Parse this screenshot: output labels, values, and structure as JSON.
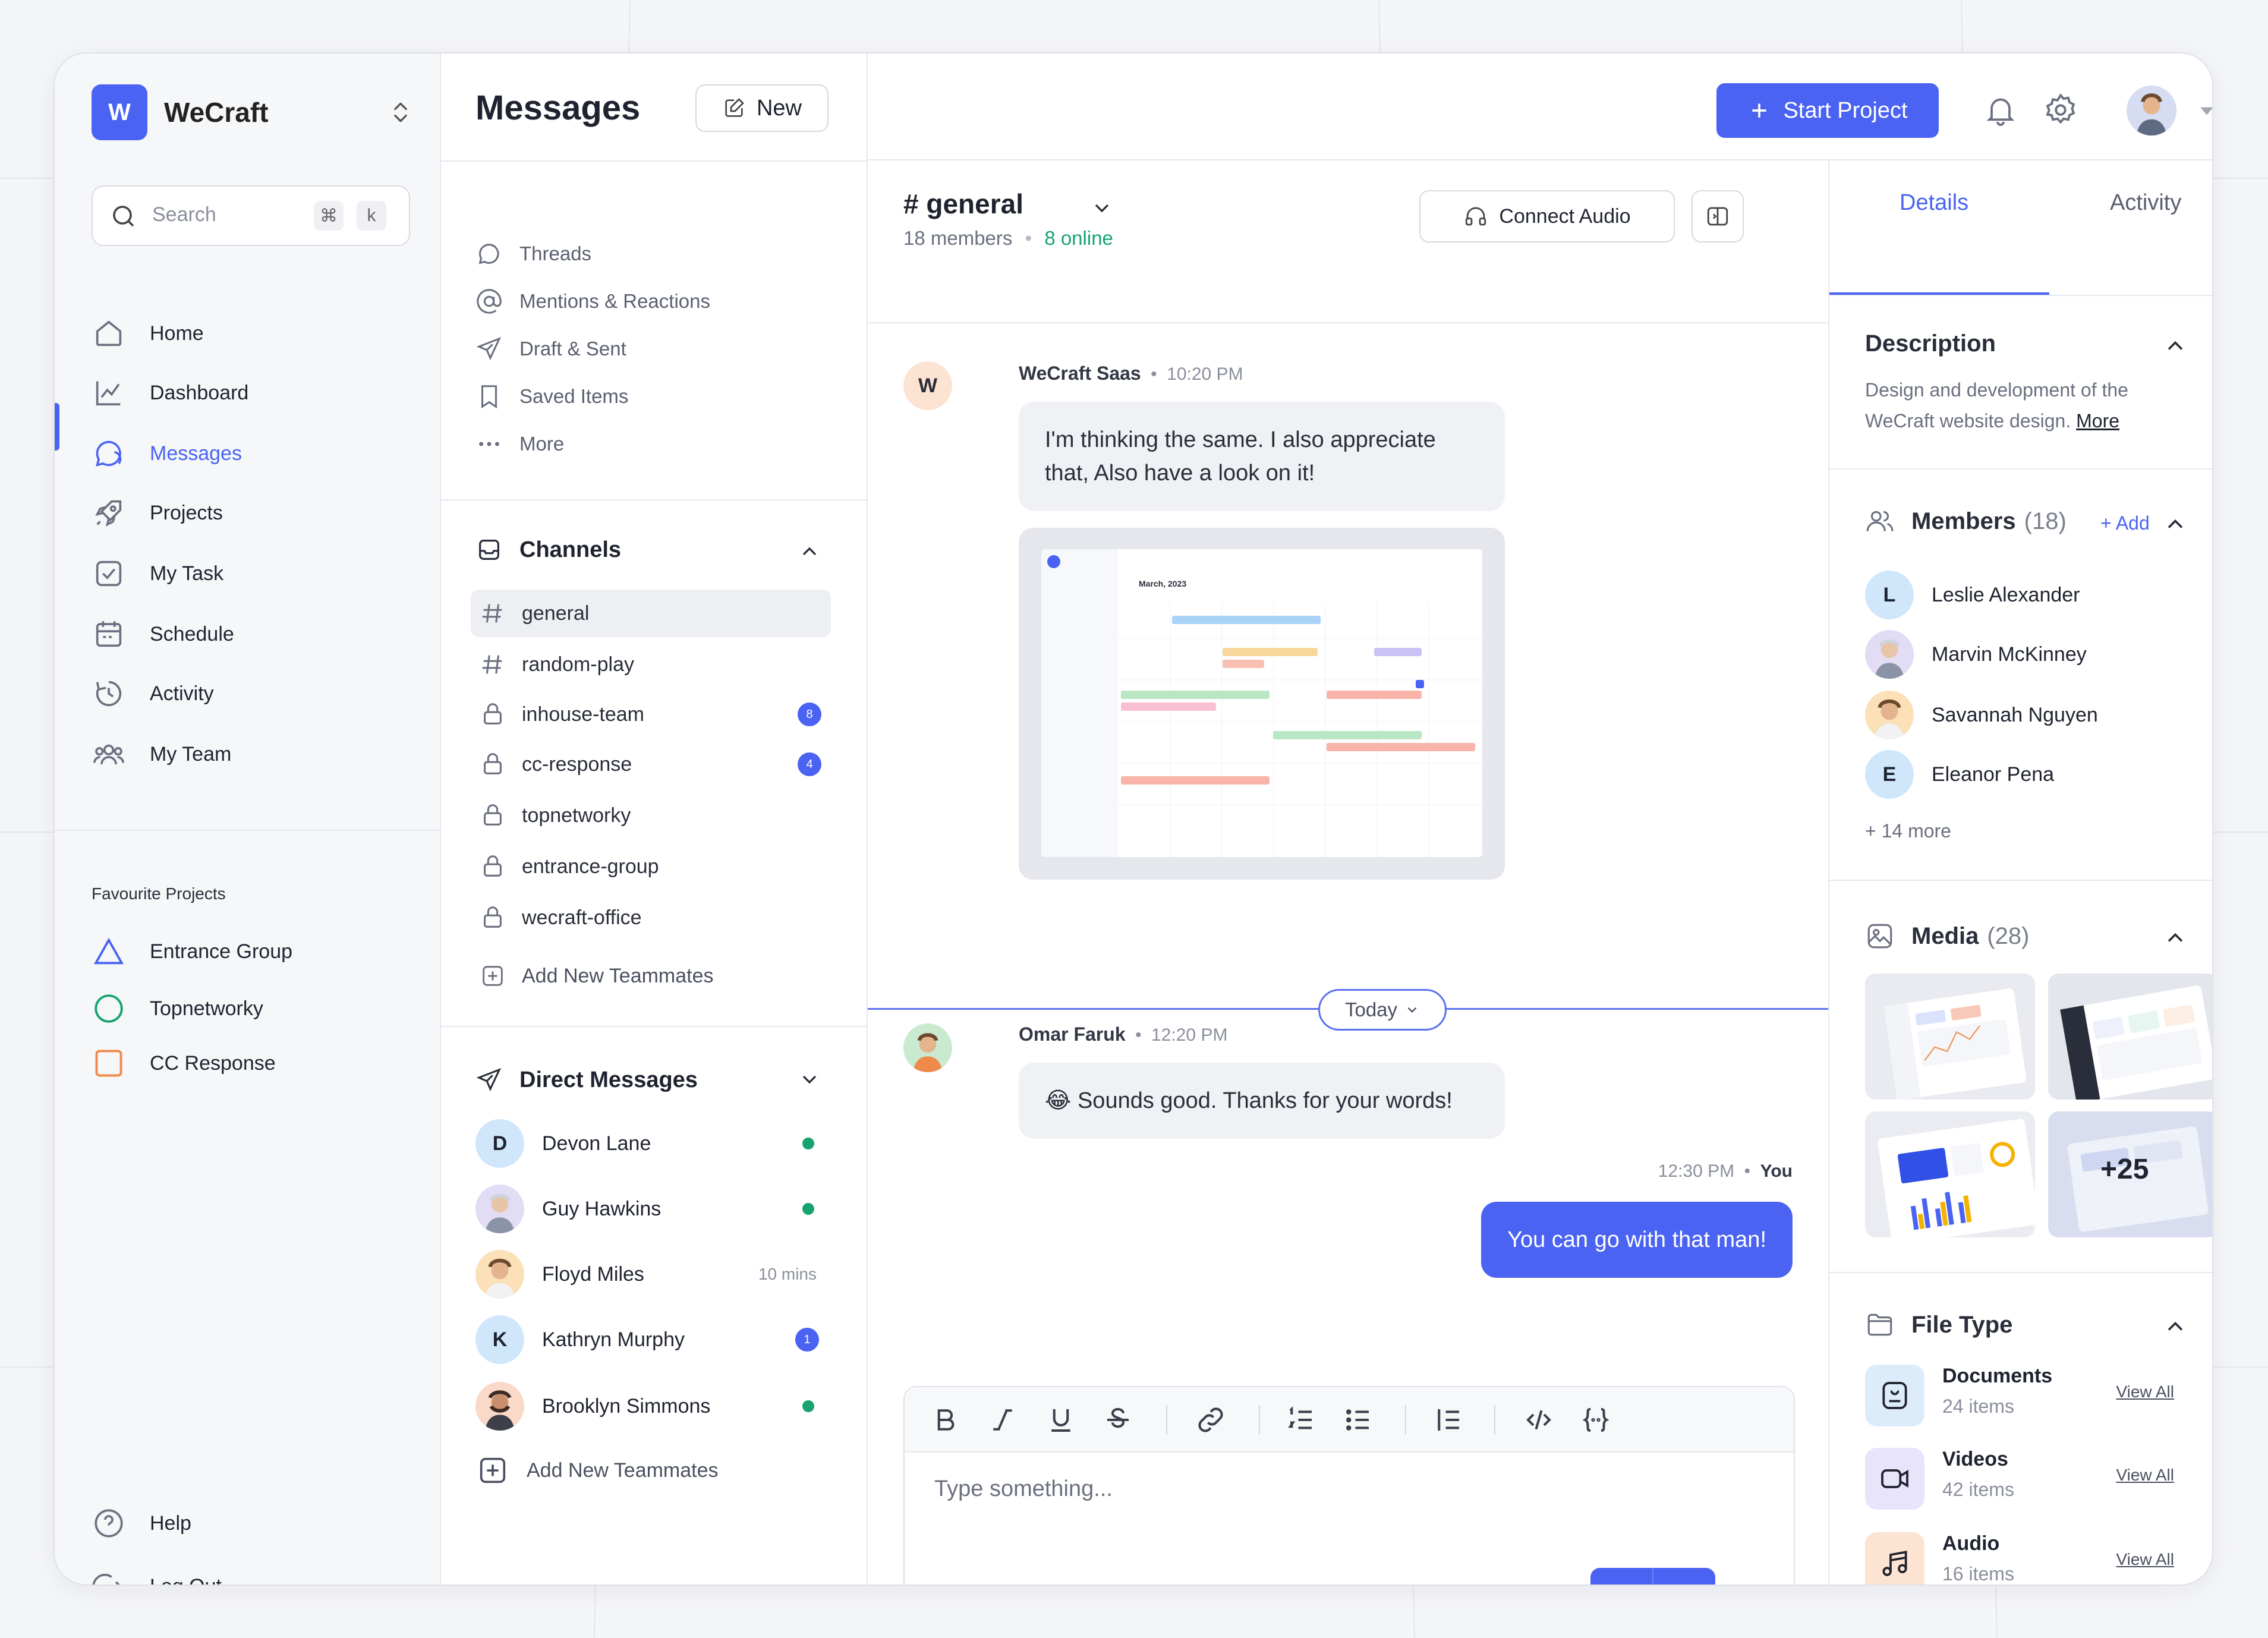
{
  "app": {
    "logo_letter": "W",
    "name": "WeCraft"
  },
  "search": {
    "placeholder": "Search",
    "shortcut_key1": "⌘",
    "shortcut_key2": "k"
  },
  "nav": [
    {
      "label": "Home",
      "icon": "home-icon"
    },
    {
      "label": "Dashboard",
      "icon": "chart-icon"
    },
    {
      "label": "Messages",
      "icon": "messages-icon",
      "active": true
    },
    {
      "label": "Projects",
      "icon": "rocket-icon"
    },
    {
      "label": "My Task",
      "icon": "checkbox-icon"
    },
    {
      "label": "Schedule",
      "icon": "calendar-icon"
    },
    {
      "label": "Activity",
      "icon": "activity-icon"
    },
    {
      "label": "My Team",
      "icon": "team-icon"
    }
  ],
  "favourites": {
    "title": "Favourite Projects",
    "items": [
      {
        "label": "Entrance Group",
        "color": "#4a63f2"
      },
      {
        "label": "Topnetworky",
        "color": "#16a36f"
      },
      {
        "label": "CC Response",
        "color": "#f08a4b"
      }
    ]
  },
  "bottom_nav": {
    "help": "Help",
    "logout": "Log Out"
  },
  "messages": {
    "title": "Messages",
    "new_label": "New",
    "menu": [
      "Threads",
      "Mentions & Reactions",
      "Draft & Sent",
      "Saved Items",
      "More"
    ],
    "channels_title": "Channels",
    "channels": [
      {
        "name": "general",
        "type": "hash",
        "active": true
      },
      {
        "name": "random-play",
        "type": "hash"
      },
      {
        "name": "inhouse-team",
        "type": "lock",
        "badge": "8"
      },
      {
        "name": "cc-response",
        "type": "lock",
        "badge": "4"
      },
      {
        "name": "topnetworky",
        "type": "lock"
      },
      {
        "name": "entrance-group",
        "type": "lock"
      },
      {
        "name": "wecraft-office",
        "type": "lock"
      }
    ],
    "add_teammates": "Add New Teammates",
    "dm_title": "Direct Messages",
    "dms": [
      {
        "name": "Devon Lane",
        "initial": "D",
        "status": "online"
      },
      {
        "name": "Guy Hawkins",
        "initial": "",
        "status": "online"
      },
      {
        "name": "Floyd Miles",
        "initial": "",
        "meta": "10 mins"
      },
      {
        "name": "Kathryn Murphy",
        "initial": "K",
        "badge": "1"
      },
      {
        "name": "Brooklyn Simmons",
        "initial": "",
        "status": "online"
      }
    ],
    "dm_add": "Add New Teammates"
  },
  "topbar": {
    "start_project": "Start Project"
  },
  "chat": {
    "channel": "# general",
    "members": "18 members",
    "online": "8 online",
    "connect_audio": "Connect Audio",
    "messages": [
      {
        "sender": "WeCraft Saas",
        "avatar": "W",
        "time": "10:20 PM",
        "text": "I'm thinking the same. I also appreciate that, Also have a look on it!"
      },
      {
        "sender": "Omar Faruk",
        "time": "12:20 PM",
        "text": "😂 Sounds good. Thanks for your words!"
      },
      {
        "time": "12:30 PM",
        "sender_self": "You",
        "text": "You can go with that man!"
      }
    ],
    "preview": {
      "month": "March, 2023"
    },
    "today": "Today",
    "composer_placeholder": "Type something..."
  },
  "details": {
    "tabs": [
      "Details",
      "Activity"
    ],
    "description_title": "Description",
    "description_text_1": "Design and development of the",
    "description_text_2": "WeCraft website design.",
    "description_more": "More",
    "members_title": "Members",
    "members_count": "(18)",
    "members_add": "+ Add",
    "members": [
      {
        "name": "Leslie Alexander",
        "initial": "L"
      },
      {
        "name": "Marvin McKinney",
        "initial": ""
      },
      {
        "name": "Savannah Nguyen",
        "initial": ""
      },
      {
        "name": "Eleanor Pena",
        "initial": "E"
      }
    ],
    "members_more": "+ 14 more",
    "media_title": "Media",
    "media_count": "(28)",
    "media_extra": "+25",
    "filetype_title": "File Type",
    "files": [
      {
        "name": "Documents",
        "count": "24 items",
        "color": "#dcecfb",
        "icon": "document-icon"
      },
      {
        "name": "Videos",
        "count": "42 items",
        "color": "#e8e4fb",
        "icon": "video-icon"
      },
      {
        "name": "Audio",
        "count": "16 items",
        "color": "#fde3d2",
        "icon": "music-icon"
      }
    ],
    "view_all": "View All"
  }
}
